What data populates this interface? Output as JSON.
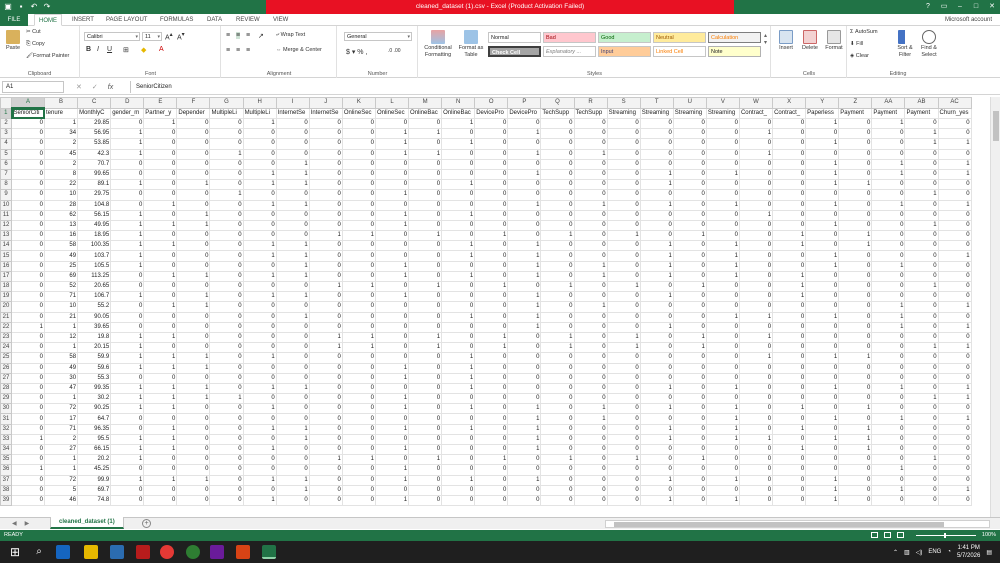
{
  "window": {
    "title": "cleaned_dataset (1).csv - Excel (Product Activation Failed)",
    "signin": "Microsoft account"
  },
  "tabs": [
    "FILE",
    "HOME",
    "INSERT",
    "PAGE LAYOUT",
    "FORMULAS",
    "DATA",
    "REVIEW",
    "VIEW"
  ],
  "ribbon": {
    "clipboard": {
      "paste": "Paste",
      "cut": "Cut",
      "copy": "Copy",
      "format_painter": "Format Painter",
      "label": "Clipboard"
    },
    "font": {
      "name": "Calibri",
      "size": "11",
      "label": "Font"
    },
    "alignment": {
      "wrap": "Wrap Text",
      "merge": "Merge & Center",
      "label": "Alignment"
    },
    "number": {
      "format": "General",
      "label": "Number"
    },
    "styles": {
      "conditional": "Conditional Formatting",
      "format_table": "Format as Table",
      "normal": "Normal",
      "bad": "Bad",
      "good": "Good",
      "neutral": "Neutral",
      "calculation": "Calculation",
      "check_cell": "Check Cell",
      "explanatory": "Explanatory ...",
      "input": "Input",
      "linked_cell": "Linked Cell",
      "note": "Note",
      "label": "Styles"
    },
    "cells": {
      "insert": "Insert",
      "delete": "Delete",
      "format": "Format",
      "label": "Cells"
    },
    "editing": {
      "autosum": "AutoSum",
      "fill": "Fill",
      "clear": "Clear",
      "sort": "Sort & Filter",
      "find": "Find & Select",
      "label": "Editing"
    }
  },
  "formula_bar": {
    "name_box": "A1",
    "content": "SeniorCitizen"
  },
  "columns": [
    "A",
    "B",
    "C",
    "D",
    "E",
    "F",
    "G",
    "H",
    "I",
    "J",
    "K",
    "L",
    "M",
    "N",
    "O",
    "P",
    "Q",
    "R",
    "S",
    "T",
    "U",
    "V",
    "W",
    "X",
    "Y",
    "Z",
    "AA",
    "AB",
    "AC"
  ],
  "headers": [
    "SeniorCiti",
    "tenure",
    "MonthlyC",
    "gender_m",
    "Partner_y",
    "Depender",
    "MultipleLi",
    "MultipleLi",
    "InternetSe",
    "InternetSe",
    "OnlineSec",
    "OnlineSec",
    "OnlineBac",
    "OnlineBac",
    "DevicePro",
    "DevicePro",
    "TechSupp",
    "TechSupp",
    "Streaming",
    "Streaming",
    "Streaming",
    "Streaming",
    "Contract_",
    "Contract_",
    "Paperless",
    "Payment",
    "Payment",
    "Payment",
    "Churn_yes"
  ],
  "rows": [
    [
      0,
      1,
      29.85,
      0,
      1,
      0,
      0,
      1,
      0,
      0,
      0,
      0,
      0,
      1,
      0,
      0,
      0,
      0,
      0,
      0,
      0,
      0,
      0,
      0,
      1,
      0,
      1,
      0,
      0
    ],
    [
      0,
      34,
      56.95,
      1,
      0,
      0,
      0,
      0,
      0,
      0,
      0,
      1,
      1,
      0,
      0,
      1,
      0,
      0,
      0,
      0,
      0,
      0,
      1,
      0,
      0,
      0,
      0,
      1,
      0
    ],
    [
      0,
      2,
      53.85,
      1,
      0,
      0,
      0,
      0,
      0,
      0,
      0,
      1,
      0,
      1,
      0,
      0,
      0,
      0,
      0,
      0,
      0,
      0,
      0,
      0,
      1,
      0,
      0,
      1,
      1
    ],
    [
      0,
      45,
      42.3,
      1,
      0,
      0,
      1,
      0,
      0,
      0,
      0,
      1,
      1,
      0,
      0,
      1,
      0,
      1,
      0,
      0,
      0,
      0,
      1,
      0,
      0,
      0,
      0,
      0,
      0
    ],
    [
      0,
      2,
      70.7,
      0,
      0,
      0,
      0,
      0,
      1,
      0,
      0,
      0,
      0,
      0,
      0,
      0,
      0,
      0,
      0,
      0,
      0,
      0,
      0,
      0,
      1,
      0,
      1,
      0,
      1
    ],
    [
      0,
      8,
      99.65,
      0,
      0,
      0,
      0,
      1,
      1,
      0,
      0,
      0,
      0,
      0,
      0,
      1,
      0,
      0,
      0,
      1,
      0,
      1,
      0,
      0,
      1,
      0,
      1,
      0,
      1
    ],
    [
      0,
      22,
      89.1,
      1,
      0,
      1,
      0,
      1,
      1,
      0,
      0,
      0,
      0,
      1,
      0,
      0,
      0,
      0,
      0,
      1,
      0,
      0,
      0,
      0,
      1,
      1,
      0,
      0,
      0
    ],
    [
      0,
      10,
      29.75,
      0,
      0,
      0,
      1,
      0,
      0,
      0,
      0,
      1,
      0,
      0,
      0,
      0,
      0,
      0,
      0,
      0,
      0,
      0,
      0,
      0,
      0,
      0,
      0,
      1,
      0
    ],
    [
      0,
      28,
      104.8,
      0,
      1,
      0,
      0,
      1,
      1,
      0,
      0,
      0,
      0,
      0,
      0,
      1,
      0,
      1,
      0,
      1,
      0,
      1,
      0,
      0,
      1,
      0,
      1,
      0,
      1
    ],
    [
      0,
      62,
      56.15,
      1,
      0,
      1,
      0,
      0,
      0,
      0,
      0,
      1,
      0,
      1,
      0,
      0,
      0,
      0,
      0,
      0,
      0,
      0,
      1,
      0,
      0,
      0,
      0,
      0,
      0
    ],
    [
      0,
      13,
      49.95,
      1,
      1,
      1,
      0,
      0,
      0,
      0,
      0,
      1,
      0,
      0,
      0,
      0,
      0,
      0,
      0,
      0,
      0,
      0,
      0,
      0,
      1,
      0,
      0,
      1,
      0
    ],
    [
      0,
      16,
      18.95,
      1,
      0,
      0,
      0,
      0,
      0,
      1,
      1,
      0,
      1,
      0,
      1,
      0,
      1,
      0,
      1,
      0,
      1,
      0,
      0,
      1,
      0,
      1,
      0,
      0,
      0
    ],
    [
      0,
      58,
      100.35,
      1,
      1,
      0,
      0,
      1,
      1,
      0,
      0,
      0,
      0,
      1,
      0,
      1,
      0,
      0,
      0,
      1,
      0,
      1,
      0,
      1,
      0,
      1,
      0,
      0,
      0
    ],
    [
      0,
      49,
      103.7,
      1,
      0,
      0,
      0,
      1,
      1,
      0,
      0,
      0,
      0,
      1,
      0,
      1,
      0,
      0,
      0,
      1,
      0,
      1,
      0,
      0,
      1,
      0,
      0,
      0,
      1
    ],
    [
      0,
      25,
      105.5,
      1,
      0,
      0,
      0,
      0,
      1,
      0,
      0,
      1,
      0,
      0,
      0,
      1,
      0,
      1,
      0,
      1,
      0,
      1,
      0,
      0,
      1,
      0,
      1,
      0,
      0
    ],
    [
      0,
      69,
      113.25,
      0,
      1,
      1,
      0,
      1,
      1,
      0,
      0,
      1,
      0,
      1,
      0,
      1,
      0,
      1,
      0,
      1,
      0,
      1,
      0,
      1,
      0,
      0,
      0,
      0,
      0
    ],
    [
      0,
      52,
      20.65,
      0,
      0,
      0,
      0,
      0,
      0,
      1,
      1,
      0,
      1,
      0,
      1,
      0,
      1,
      0,
      1,
      0,
      1,
      0,
      0,
      1,
      0,
      0,
      0,
      1,
      0
    ],
    [
      0,
      71,
      106.7,
      1,
      0,
      1,
      0,
      1,
      1,
      0,
      0,
      1,
      0,
      0,
      0,
      1,
      0,
      0,
      0,
      1,
      0,
      0,
      0,
      1,
      0,
      0,
      0,
      0,
      0
    ],
    [
      0,
      10,
      55.2,
      0,
      1,
      1,
      0,
      0,
      0,
      0,
      0,
      0,
      0,
      0,
      0,
      1,
      0,
      1,
      0,
      0,
      0,
      0,
      0,
      0,
      0,
      0,
      1,
      0,
      1
    ],
    [
      0,
      21,
      90.05,
      0,
      0,
      0,
      0,
      0,
      1,
      0,
      0,
      0,
      0,
      1,
      0,
      1,
      0,
      0,
      0,
      0,
      0,
      1,
      1,
      0,
      1,
      0,
      1,
      0,
      0
    ],
    [
      1,
      1,
      39.65,
      0,
      0,
      0,
      0,
      0,
      0,
      0,
      0,
      0,
      0,
      0,
      0,
      1,
      0,
      0,
      0,
      1,
      0,
      0,
      0,
      0,
      0,
      0,
      1,
      0,
      1
    ],
    [
      0,
      12,
      19.8,
      1,
      1,
      0,
      0,
      0,
      0,
      1,
      1,
      0,
      1,
      0,
      1,
      0,
      1,
      0,
      1,
      0,
      1,
      0,
      1,
      0,
      0,
      0,
      0,
      0,
      0
    ],
    [
      0,
      1,
      20.15,
      1,
      0,
      0,
      0,
      0,
      0,
      1,
      1,
      0,
      1,
      0,
      1,
      0,
      1,
      0,
      1,
      0,
      1,
      0,
      0,
      0,
      0,
      0,
      0,
      1,
      1
    ],
    [
      0,
      58,
      59.9,
      1,
      1,
      1,
      0,
      1,
      0,
      0,
      0,
      0,
      0,
      1,
      0,
      0,
      0,
      0,
      0,
      0,
      0,
      0,
      1,
      0,
      1,
      1,
      0,
      0,
      0
    ],
    [
      0,
      49,
      59.6,
      1,
      1,
      1,
      0,
      0,
      0,
      0,
      0,
      1,
      0,
      1,
      0,
      0,
      0,
      0,
      0,
      0,
      0,
      0,
      0,
      0,
      0,
      0,
      0,
      0,
      0
    ],
    [
      0,
      30,
      55.3,
      0,
      0,
      0,
      0,
      0,
      0,
      0,
      0,
      1,
      0,
      1,
      0,
      0,
      0,
      0,
      0,
      0,
      0,
      0,
      0,
      0,
      0,
      0,
      0,
      0,
      0
    ],
    [
      0,
      47,
      99.35,
      1,
      1,
      1,
      0,
      1,
      1,
      0,
      0,
      0,
      0,
      1,
      0,
      0,
      0,
      0,
      0,
      1,
      0,
      1,
      0,
      0,
      1,
      0,
      1,
      0,
      1
    ],
    [
      0,
      1,
      30.2,
      1,
      1,
      1,
      1,
      0,
      0,
      0,
      0,
      1,
      0,
      0,
      0,
      0,
      0,
      0,
      0,
      0,
      0,
      0,
      0,
      0,
      0,
      0,
      0,
      1,
      1
    ],
    [
      0,
      72,
      90.25,
      1,
      1,
      0,
      0,
      1,
      0,
      0,
      0,
      1,
      0,
      1,
      0,
      1,
      0,
      1,
      0,
      1,
      0,
      1,
      0,
      1,
      0,
      1,
      0,
      0,
      0
    ],
    [
      0,
      17,
      64.7,
      0,
      0,
      0,
      0,
      0,
      0,
      0,
      0,
      0,
      0,
      0,
      0,
      1,
      0,
      1,
      0,
      0,
      0,
      1,
      0,
      0,
      1,
      0,
      1,
      0,
      1
    ],
    [
      0,
      71,
      96.35,
      0,
      1,
      0,
      0,
      1,
      1,
      0,
      0,
      1,
      0,
      1,
      0,
      1,
      0,
      0,
      0,
      1,
      0,
      1,
      0,
      1,
      0,
      1,
      0,
      0,
      0
    ],
    [
      1,
      2,
      95.5,
      1,
      1,
      0,
      0,
      0,
      1,
      0,
      0,
      0,
      0,
      0,
      0,
      1,
      0,
      0,
      0,
      1,
      0,
      1,
      1,
      0,
      1,
      1,
      0,
      0,
      0
    ],
    [
      0,
      27,
      66.15,
      1,
      1,
      0,
      0,
      1,
      0,
      0,
      0,
      1,
      0,
      0,
      0,
      1,
      0,
      0,
      0,
      0,
      0,
      0,
      0,
      1,
      0,
      1,
      0,
      0,
      0
    ],
    [
      0,
      1,
      20.2,
      1,
      0,
      0,
      0,
      0,
      0,
      1,
      1,
      0,
      1,
      0,
      1,
      0,
      1,
      0,
      1,
      0,
      1,
      0,
      0,
      0,
      0,
      0,
      0,
      1,
      0
    ],
    [
      1,
      1,
      45.25,
      0,
      0,
      0,
      0,
      0,
      0,
      0,
      0,
      1,
      0,
      0,
      0,
      0,
      0,
      0,
      0,
      0,
      0,
      0,
      0,
      0,
      0,
      0,
      1,
      0,
      0
    ],
    [
      0,
      72,
      99.9,
      1,
      1,
      1,
      0,
      1,
      1,
      0,
      0,
      1,
      0,
      1,
      0,
      1,
      0,
      0,
      0,
      1,
      0,
      1,
      0,
      0,
      1,
      0,
      0,
      0,
      0
    ],
    [
      0,
      5,
      69.7,
      0,
      0,
      0,
      0,
      0,
      1,
      0,
      0,
      0,
      0,
      0,
      0,
      0,
      0,
      0,
      0,
      0,
      0,
      0,
      0,
      0,
      1,
      0,
      1,
      0,
      1
    ],
    [
      0,
      46,
      74.8,
      0,
      0,
      0,
      0,
      1,
      0,
      0,
      0,
      1,
      0,
      0,
      0,
      0,
      0,
      0,
      0,
      1,
      0,
      1,
      0,
      0,
      1,
      0,
      0,
      0,
      0
    ]
  ],
  "sheet_tab": "cleaned_dataset (1)",
  "status": {
    "ready": "READY",
    "zoom": "100%"
  },
  "taskbar": {
    "time": "1:41 PM",
    "date": "5/7/2026",
    "lang": "ENG"
  },
  "colors": {
    "excel_green": "#217346",
    "title_alert": "#e81123"
  }
}
